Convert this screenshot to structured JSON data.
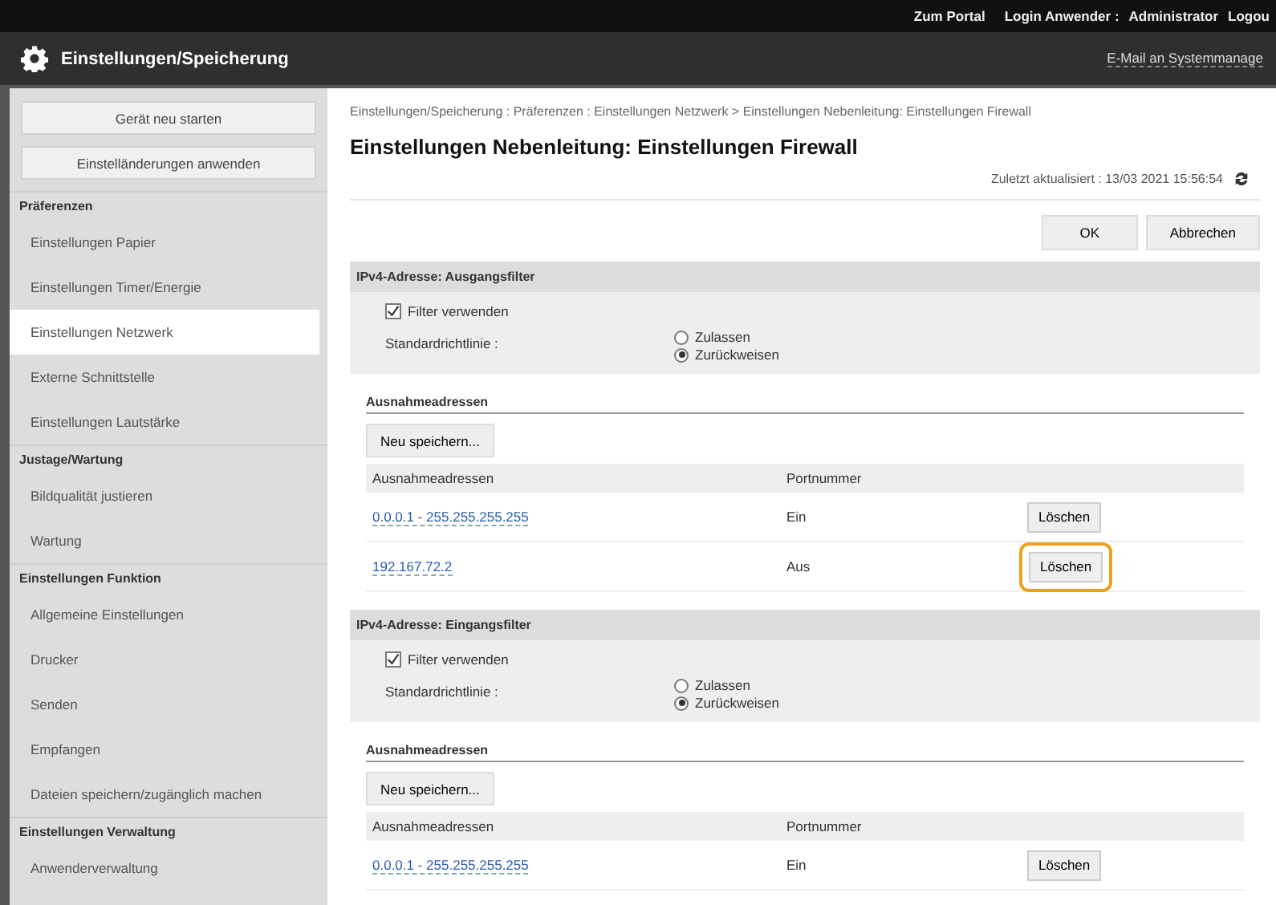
{
  "topbar": {
    "portal_link": "Zum Portal",
    "login_label": "Login Anwender :",
    "user": "Administrator",
    "logout_link": "Logou",
    "mail_link": "E-Mail an Systemmanage"
  },
  "header": {
    "title": "Einstellungen/Speicherung"
  },
  "sidebar": {
    "buttons": [
      "Gerät neu starten",
      "Einstelländerungen anwenden"
    ],
    "groups": [
      {
        "heading": "Präferenzen",
        "items": [
          {
            "label": "Einstellungen Papier",
            "selected": false
          },
          {
            "label": "Einstellungen Timer/Energie",
            "selected": false
          },
          {
            "label": "Einstellungen Netzwerk",
            "selected": true
          },
          {
            "label": "Externe Schnittstelle",
            "selected": false
          },
          {
            "label": "Einstellungen Lautstärke",
            "selected": false
          }
        ]
      },
      {
        "heading": "Justage/Wartung",
        "items": [
          {
            "label": "Bildqualität justieren",
            "selected": false
          },
          {
            "label": "Wartung",
            "selected": false
          }
        ]
      },
      {
        "heading": "Einstellungen Funktion",
        "items": [
          {
            "label": "Allgemeine Einstellungen",
            "selected": false
          },
          {
            "label": "Drucker",
            "selected": false
          },
          {
            "label": "Senden",
            "selected": false
          },
          {
            "label": "Empfangen",
            "selected": false
          },
          {
            "label": "Dateien speichern/zugänglich machen",
            "selected": false
          }
        ]
      },
      {
        "heading": "Einstellungen Verwaltung",
        "items": [
          {
            "label": "Anwenderverwaltung",
            "selected": false
          }
        ]
      }
    ]
  },
  "main": {
    "breadcrumb": "Einstellungen/Speicherung : Präferenzen : Einstellungen Netzwerk > Einstellungen Nebenleitung: Einstellungen Firewall",
    "title": "Einstellungen Nebenleitung: Einstellungen Firewall",
    "updated": "Zuletzt aktualisiert : 13/03 2021 15:56:54",
    "buttons": [
      "OK",
      "Abbrechen"
    ],
    "filters": [
      {
        "title": "IPv4-Adresse: Ausgangsfilter",
        "checkbox": {
          "label": "Filter verwenden",
          "checked": true
        },
        "policy_label": "Standardrichtlinie :",
        "options": [
          {
            "label": "Zulassen",
            "selected": false
          },
          {
            "label": "Zurückweisen",
            "selected": true
          }
        ],
        "exceptions": {
          "heading": "Ausnahmeadressen",
          "new_button": "Neu speichern...",
          "columns": [
            "Ausnahmeadressen",
            "Portnummer"
          ],
          "rows": [
            {
              "address": "0.0.0.1 - 255.255.255.255",
              "port": "Ein",
              "delete": "Löschen",
              "highlighted": false
            },
            {
              "address": "192.167.72.2",
              "port": "Aus",
              "delete": "Löschen",
              "highlighted": true
            }
          ]
        }
      },
      {
        "title": "IPv4-Adresse: Eingangsfilter",
        "checkbox": {
          "label": "Filter verwenden",
          "checked": true
        },
        "policy_label": "Standardrichtlinie :",
        "options": [
          {
            "label": "Zulassen",
            "selected": false
          },
          {
            "label": "Zurückweisen",
            "selected": true
          }
        ],
        "exceptions": {
          "heading": "Ausnahmeadressen",
          "new_button": "Neu speichern...",
          "columns": [
            "Ausnahmeadressen",
            "Portnummer"
          ],
          "rows": [
            {
              "address": "0.0.0.1 - 255.255.255.255",
              "port": "Ein",
              "delete": "Löschen",
              "highlighted": false
            }
          ]
        }
      }
    ]
  }
}
